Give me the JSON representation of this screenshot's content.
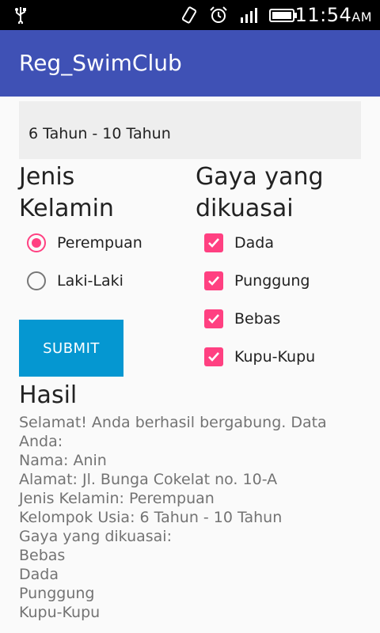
{
  "status_bar": {
    "time": "11:54",
    "ampm": "AM",
    "icons": [
      "usb-icon",
      "vibrate-icon",
      "alarm-icon",
      "signal-icon",
      "battery-icon"
    ]
  },
  "app_bar": {
    "title": "Reg_SwimClub"
  },
  "form": {
    "age_group_value": "6 Tahun - 10 Tahun",
    "gender_title_line1": "Jenis",
    "gender_title_line2": "Kelamin",
    "gender_options": [
      {
        "label": "Perempuan",
        "checked": true
      },
      {
        "label": "Laki-Laki",
        "checked": false
      }
    ],
    "style_title_line1": "Gaya yang",
    "style_title_line2": "dikuasai",
    "style_options": [
      {
        "label": "Dada",
        "checked": true
      },
      {
        "label": "Punggung",
        "checked": true
      },
      {
        "label": "Bebas",
        "checked": true
      },
      {
        "label": "Kupu-Kupu",
        "checked": true
      }
    ],
    "submit_label": "SUBMIT"
  },
  "result": {
    "title": "Hasil",
    "lines": [
      "Selamat! Anda berhasil bergabung. Data",
      "Anda:",
      "Nama: Anin",
      "Alamat: Jl. Bunga Cokelat no. 10-A",
      "Jenis Kelamin: Perempuan",
      "Kelompok Usia: 6 Tahun - 10 Tahun",
      "Gaya yang dikuasai:",
      "Bebas",
      "Dada",
      "Punggung",
      "Kupu-Kupu"
    ]
  },
  "colors": {
    "primary": "#3f51b5",
    "accent": "#ff4081",
    "button": "#0597d1"
  }
}
